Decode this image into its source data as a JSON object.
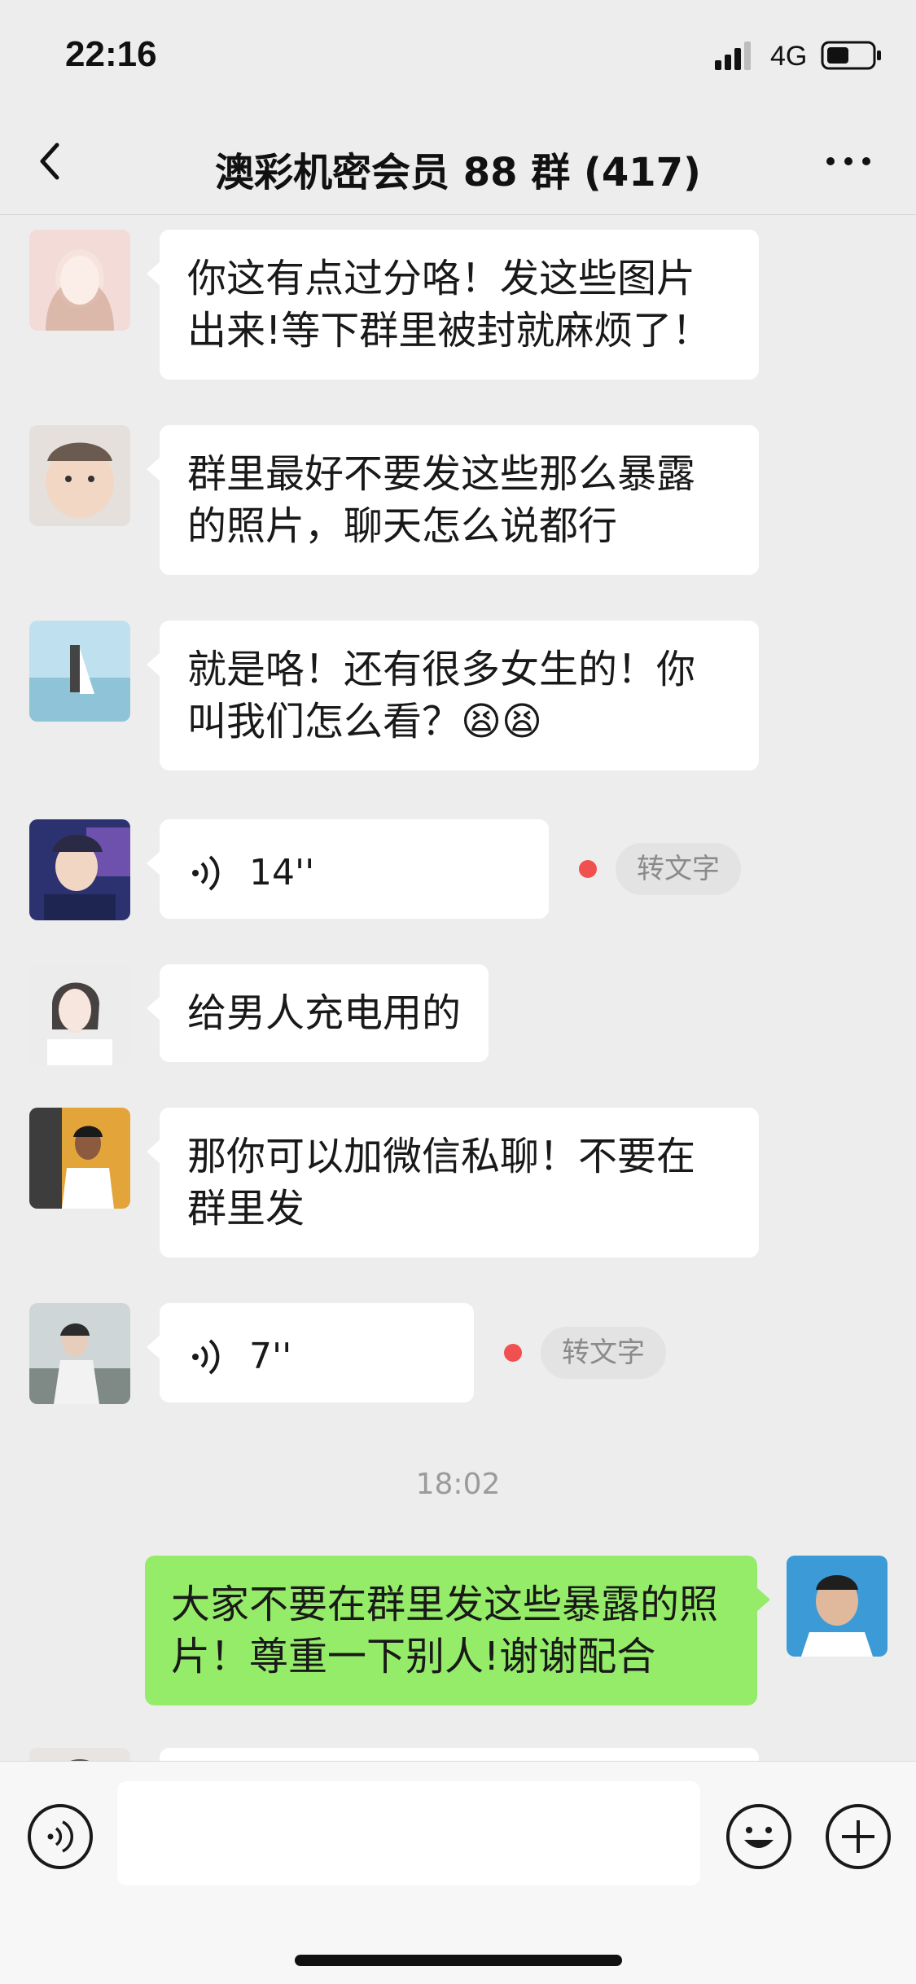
{
  "status_bar": {
    "time": "22:16",
    "network": "4G"
  },
  "nav": {
    "title": "澳彩机密会员 88 群 (417)"
  },
  "messages": [
    {
      "type": "text",
      "text": "你这有点过分咯！发这些图片出来!等下群里被封就麻烦了！"
    },
    {
      "type": "text",
      "text": "群里最好不要发这些那么暴露的照片，聊天怎么说都行"
    },
    {
      "type": "text",
      "text": "就是咯！还有很多女生的！你叫我们怎么看？😫😫"
    },
    {
      "type": "voice",
      "duration": "14''",
      "to_text_label": "转文字"
    },
    {
      "type": "text",
      "text": "给男人充电用的"
    },
    {
      "type": "text",
      "text": "那你可以加微信私聊！不要在群里发"
    },
    {
      "type": "voice",
      "duration": "7''",
      "to_text_label": "转文字"
    }
  ],
  "divider_time": "18:02",
  "self_message": {
    "text": "大家不要在群里发这些暴露的照片！尊重一下别人!谢谢配合"
  },
  "colors": {
    "background": "#ededed",
    "self_bubble": "#95ec69",
    "other_bubble": "#ffffff",
    "unread_dot": "#f0504f"
  },
  "icons": [
    "back-icon",
    "more-icon",
    "voice-icon",
    "emoji-icon",
    "plus-icon",
    "signal-icon",
    "battery-icon"
  ]
}
